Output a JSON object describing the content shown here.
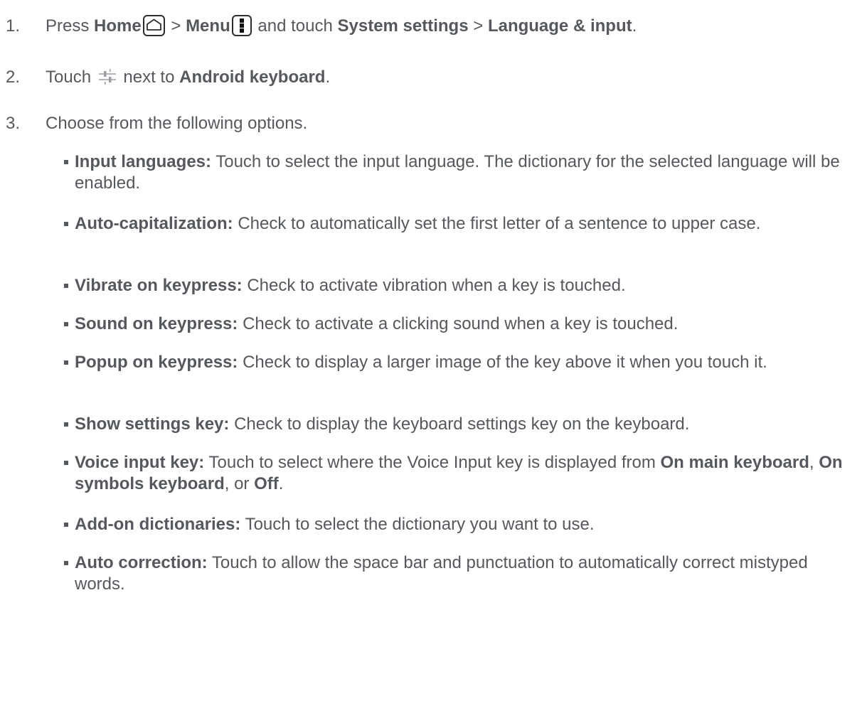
{
  "steps": [
    {
      "number": "1.",
      "parts": {
        "t1": "Press ",
        "home": "Home",
        "t2": " > ",
        "menu": "Menu",
        "t3": " and touch ",
        "system_settings": "System settings",
        "t4": " > ",
        "language_input": "Language & input",
        "t5": "."
      }
    },
    {
      "number": "2.",
      "parts": {
        "t1": "Touch ",
        "t2": " next to ",
        "android_keyboard": "Android keyboard",
        "t3": "."
      }
    },
    {
      "number": "3.",
      "text": "Choose from the following options."
    }
  ],
  "options": [
    {
      "term": "Input languages:",
      "desc": "Touch to select the input language. The dictionary for the selected language will be enabled."
    },
    {
      "term": "Auto-capitalization:",
      "desc": "Check to automatically set the first letter of a sentence to upper case."
    },
    {
      "term": "Vibrate on keypress:",
      "desc": "Check to activate vibration when a key is touched."
    },
    {
      "term": "Sound on keypress:",
      "desc": "Check to activate a clicking sound when a key is touched."
    },
    {
      "term": "Popup on keypress:",
      "desc": "Check to display a larger image of the key above it when you touch it."
    },
    {
      "term": "Show settings key:",
      "desc": "Check to display the keyboard settings key on the keyboard."
    },
    {
      "term": "Voice input key:",
      "desc": "Touch to select where the Voice Input key is displayed from ",
      "choice1": "On main keyboard",
      "sep1": ", ",
      "choice2": "On symbols keyboard",
      "sep2": ", or ",
      "choice3": "Off",
      "end": "."
    },
    {
      "term": "Add-on dictionaries:",
      "desc": "Touch to select the dictionary you want to use."
    },
    {
      "term": "Auto correction:",
      "desc": "Touch to allow the space bar and punctuation to automatically correct mistyped words."
    }
  ],
  "icons": {
    "home": "home-key-icon",
    "menu": "menu-key-icon",
    "settings": "sliders-settings-icon"
  },
  "colors": {
    "text": "#55585c",
    "icon_outline": "#2d2d2d",
    "slider_icon": "#9a9ea3"
  }
}
